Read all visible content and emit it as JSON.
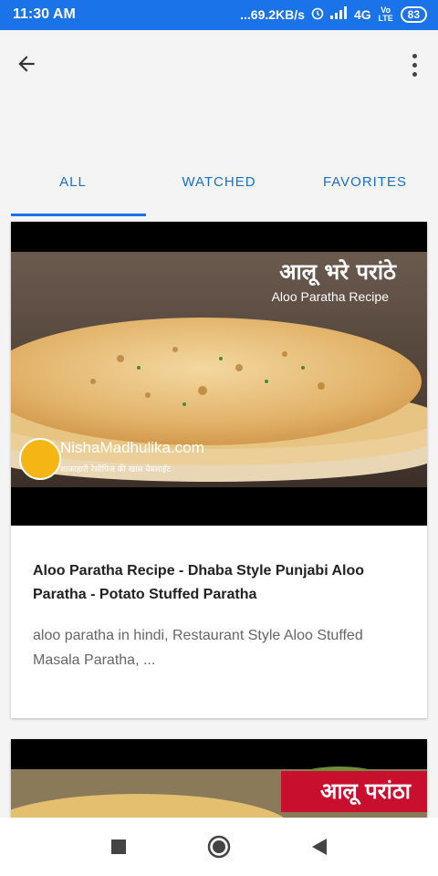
{
  "status_bar": {
    "time": "11:30 AM",
    "net_speed": "...69.2KB/s",
    "network": "4G",
    "volte": "Vo LTE",
    "battery": "83"
  },
  "tabs": [
    {
      "label": "ALL"
    },
    {
      "label": "WATCHED"
    },
    {
      "label": "FAVORITES"
    }
  ],
  "videos": [
    {
      "thumb_overlay_hindi": "आलू भरे परांठे",
      "thumb_overlay_en": "Aloo Paratha Recipe",
      "thumb_brand": "NishaMadhulika.com",
      "thumb_brand_tagline": "शाकाहारी रेसीपिज की खास वेबसाईट",
      "title": "Aloo Paratha Recipe - Dhaba Style Punjabi Aloo Paratha - Potato Stuffed Paratha",
      "description": "aloo paratha in hindi, Restaurant Style Aloo Stuffed Masala Paratha, ..."
    },
    {
      "thumb_overlay_hindi": "आलू परांठा"
    }
  ],
  "icons": {
    "back": "arrow-back-icon",
    "menu": "more-vert-icon",
    "nav_recent": "square-icon",
    "nav_home": "circle-icon",
    "nav_back": "triangle-back-icon"
  },
  "colors": {
    "status_bar": "#1a73e8",
    "accent": "#1a73e8",
    "tab_text": "#1a6fc9"
  }
}
